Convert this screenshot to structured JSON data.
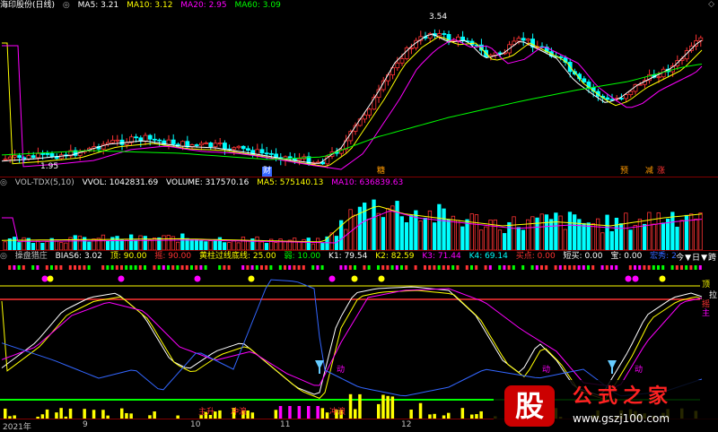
{
  "main": {
    "title": "海印股份(日线)",
    "indicators": [
      {
        "label": "MA5: 3.21",
        "color": "#ffffff"
      },
      {
        "label": "MA10: 3.12",
        "color": "#ffff00"
      },
      {
        "label": "MA20: 2.95",
        "color": "#ff00ff"
      },
      {
        "label": "MA60: 3.09",
        "color": "#00ff00"
      }
    ],
    "high_marker": "3.54",
    "low_marker": "1.95",
    "tags": [
      {
        "text": "财",
        "color": "#3366ff"
      },
      {
        "text": "糖",
        "color": "#ff9900"
      },
      {
        "text": "预",
        "color": "#ff9900"
      },
      {
        "text": "减",
        "color": "#ff9900"
      },
      {
        "text": "涨",
        "color": "#ff3333"
      }
    ]
  },
  "volume": {
    "indicators": [
      {
        "label": "VOL-TDX(5,10)",
        "color": "#c0c0c0"
      },
      {
        "label": "VVOL: 1042831.69",
        "color": "#ffffff"
      },
      {
        "label": "VOLUME: 317570.16",
        "color": "#ffffff"
      },
      {
        "label": "MA5: 575140.13",
        "color": "#ffff00"
      },
      {
        "label": "MA10: 636839.63",
        "color": "#ff00ff"
      }
    ]
  },
  "lower": {
    "indicators": [
      {
        "label": "操盘猎庄",
        "color": "#c0c0c0"
      },
      {
        "label": "BIAS6: 3.02",
        "color": "#ffffff"
      },
      {
        "label": "顶: 90.00",
        "color": "#ffff00"
      },
      {
        "label": "摇: 90.00",
        "color": "#ff3333"
      },
      {
        "label": "黄柱过线底线: 25.00",
        "color": "#ffff00"
      },
      {
        "label": "弱: 10.00",
        "color": "#00ff00"
      },
      {
        "label": "K1: 79.54",
        "color": "#ffffff"
      },
      {
        "label": "K2: 82.59",
        "color": "#ffff00"
      },
      {
        "label": "K3: 71.44",
        "color": "#ff00ff"
      },
      {
        "label": "K4: 69.14",
        "color": "#00ffff"
      },
      {
        "label": "买点: 0.00",
        "color": "#ff3333"
      },
      {
        "label": "短买: 0.00",
        "color": "#ffffff"
      },
      {
        "label": "宝: 0.00",
        "color": "#ffffff"
      },
      {
        "label": "宏秀: 27.63",
        "color": "#3366ff"
      }
    ],
    "right_labels": [
      {
        "text": "顶",
        "color": "#ffff00"
      },
      {
        "text": "拉",
        "color": "#ffffff"
      },
      {
        "text": "摇",
        "color": "#ff3333"
      },
      {
        "text": "主",
        "color": "#ff00ff"
      }
    ],
    "dong_labels": [
      "动",
      "动",
      "动"
    ],
    "bottom_tags": [
      "主升",
      "冲浪",
      "冲浪"
    ]
  },
  "tabs": [
    "今",
    "▼",
    "日",
    "▼",
    "跨"
  ],
  "date_axis": [
    "2021年",
    "9",
    "10",
    "11",
    "12"
  ],
  "watermark": {
    "title": "公式之家",
    "url": "www.gszj100.com",
    "logo": "股"
  }
}
